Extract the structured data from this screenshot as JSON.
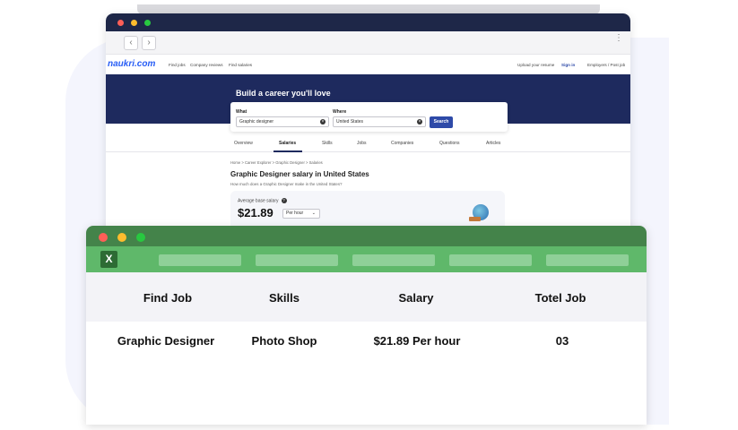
{
  "colors": {
    "browser_titlebar": "#1e2748",
    "hero_bg": "#1e2a5e",
    "search_button": "#2e4aa8",
    "logo_blue": "#275df5",
    "sheet_titlebar": "#44834a",
    "sheet_toolbar": "#5fb86a",
    "dot_red": "#ff5f57",
    "dot_yellow": "#febc2e",
    "dot_green": "#28c840"
  },
  "browser": {
    "back_icon": "‹",
    "forward_icon": "›",
    "menu_icon": "⋮"
  },
  "naukri": {
    "logo": "naukri.com",
    "nav": {
      "find_jobs": "Find jobs",
      "company_reviews": "Company reviews",
      "find_salaries": "Find salaries",
      "upload_resume": "Upload your resume",
      "sign_in": "Sign in",
      "employers": "Employers / Post job"
    },
    "hero_title": "Build a career you'll love",
    "search": {
      "what_label": "What",
      "what_value": "Graphic designer",
      "where_label": "Where",
      "where_value": "United States",
      "button": "Search"
    },
    "tabs": [
      "Overview",
      "Salaries",
      "Skills",
      "Jobs",
      "Companies",
      "Questions",
      "Articles"
    ],
    "breadcrumb": "Home > Career Explorer > Graphic Designer > Salaries",
    "page_title": "Graphic Designer salary in United States",
    "page_subtitle": "How much does a Graphic Designer make in the United States?",
    "salary_card": {
      "label": "Average base salary",
      "help": "?",
      "amount": "$21.89",
      "period": "Per hour"
    }
  },
  "sheet": {
    "app_icon": "X",
    "headers": [
      "Find Job",
      "Skills",
      "Salary",
      "Totel Job"
    ],
    "row": [
      "Graphic Designer",
      "Photo Shop",
      "$21.89 Per hour",
      "03"
    ]
  }
}
